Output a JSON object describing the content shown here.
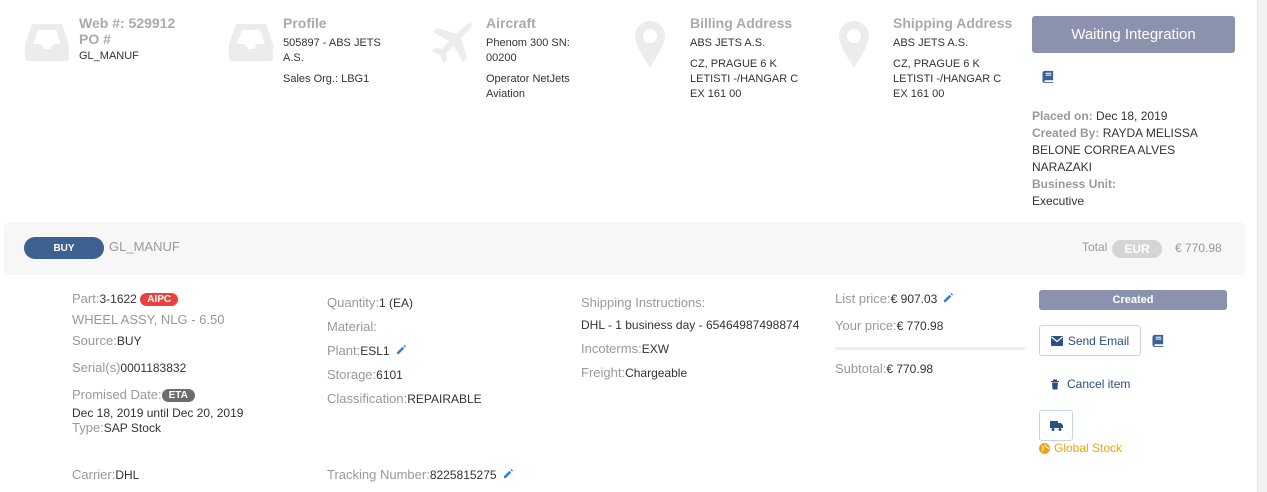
{
  "header": {
    "web": {
      "web_label": "Web #: 529912",
      "po_label": "PO #",
      "po_value": "GL_MANUF",
      "icon": "inbox-icon"
    },
    "profile": {
      "title": "Profile",
      "line1": "505897 - ABS JETS",
      "line2": "A.S.",
      "line3": "Sales Org.: LBG1",
      "icon": "inbox-icon"
    },
    "aircraft": {
      "title": "Aircraft",
      "line1": "Phenom 300 SN:",
      "line2": "00200",
      "line3": "Operator NetJets",
      "line4": "Aviation",
      "icon": "plane-icon"
    },
    "billing": {
      "title": "Billing Address",
      "line1": "ABS JETS A.S.",
      "line2": "CZ, PRAGUE 6 K",
      "line3": "LETISTI -/HANGAR C",
      "line4": "EX 161 00",
      "icon": "map-marker-icon"
    },
    "shipping": {
      "title": "Shipping Address",
      "line1": "ABS JETS A.S.",
      "line2": "CZ, PRAGUE 6 K",
      "line3": "LETISTI -/HANGAR C",
      "line4": "EX 161 00",
      "icon": "map-marker-icon"
    }
  },
  "status": {
    "button": "Waiting Integration",
    "placed_label": "Placed on:",
    "placed_value": "Dec 18, 2019",
    "created_label": "Created By:",
    "created_value1": "RAYDA MELISSA",
    "created_value2": "BELONE CORREA ALVES",
    "created_value3": "NARAZAKI",
    "unit_label": "Business Unit:",
    "unit_value": "Executive"
  },
  "order": {
    "type_badge": "BUY",
    "name": "GL_MANUF",
    "total_label": "Total",
    "currency": "EUR",
    "total_value": "€ 770.98"
  },
  "item": {
    "part_label": "Part:",
    "part_value": "3-1622",
    "aipc_badge": "AIPC",
    "description": "WHEEL ASSY, NLG - 6.50",
    "source_label": "Source:",
    "source_value": "BUY",
    "serial_label": "Serial(s)",
    "serial_value": "0001183832",
    "promised_label": "Promised Date:",
    "eta_badge": "ETA",
    "promised_value": "Dec 18, 2019 until Dec 20, 2019",
    "type_label": "Type:",
    "type_value": "SAP Stock",
    "carrier_label": "Carrier:",
    "carrier_value": "DHL",
    "quantity_label": "Quantity:",
    "quantity_value": "1 (EA)",
    "material_label": "Material:",
    "plant_label": "Plant:",
    "plant_value": "ESL1",
    "storage_label": "Storage:",
    "storage_value": "6101",
    "classification_label": "Classification:",
    "classification_value": "REPAIRABLE",
    "tracking_label": "Tracking Number:",
    "tracking_value": "8225815275",
    "shipping_instr_label": "Shipping Instructions:",
    "shipping_instr_value": "DHL - 1 business day - 65464987498874",
    "incoterms_label": "Incoterms:",
    "incoterms_value": "EXW",
    "freight_label": "Freight:",
    "freight_value": "Chargeable",
    "list_price_label": "List price:",
    "list_price_value": "€ 907.03",
    "your_price_label": "Your price:",
    "your_price_value": "€ 770.98",
    "subtotal_label": "Subtotal:",
    "subtotal_value": "€ 770.98",
    "item_status": "Created",
    "send_email": "Send Email",
    "cancel_item": "Cancel item",
    "global_stock": "Global Stock"
  },
  "colors": {
    "accent": "#3d6190",
    "status_gray": "#8b92ad",
    "badge_red": "#e9423d",
    "link_blue": "#2e86de",
    "global_orange": "#f0a30a"
  }
}
